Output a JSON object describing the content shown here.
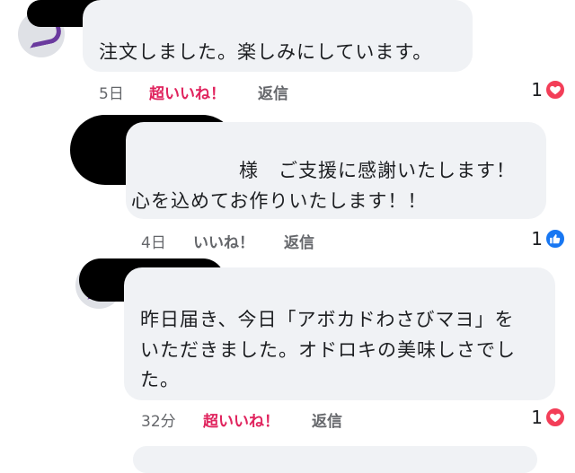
{
  "comments": [
    {
      "text_lines": [
        "注文しました。楽しみにしています。"
      ],
      "time": "5日",
      "like_label": "超いいね！",
      "reply_label": "返信",
      "reaction_count": "1",
      "reaction_icon": "heart-icon"
    },
    {
      "text_lines": [
        "様　ご支援に感謝いたします！",
        "心を込めてお作りいたします！！"
      ],
      "time": "4日",
      "like_label": "いいね！",
      "reply_label": "返信",
      "reaction_count": "1",
      "reaction_icon": "thumbs-up-icon"
    },
    {
      "text_lines": [
        "昨日届き、今日「アボカドわさびマヨ」を",
        "いただきました。オドロキの美味しさでし",
        "た。"
      ],
      "time": "32分",
      "like_label": "超いいね！",
      "reply_label": "返信",
      "reaction_count": "1",
      "reaction_icon": "heart-icon"
    }
  ],
  "colors": {
    "bubble_bg": "#f0f2f5",
    "superlike_pink": "#e0245e",
    "heart_red": "#f33e58",
    "like_blue": "#1877f2",
    "meta_gray": "#65676b"
  }
}
